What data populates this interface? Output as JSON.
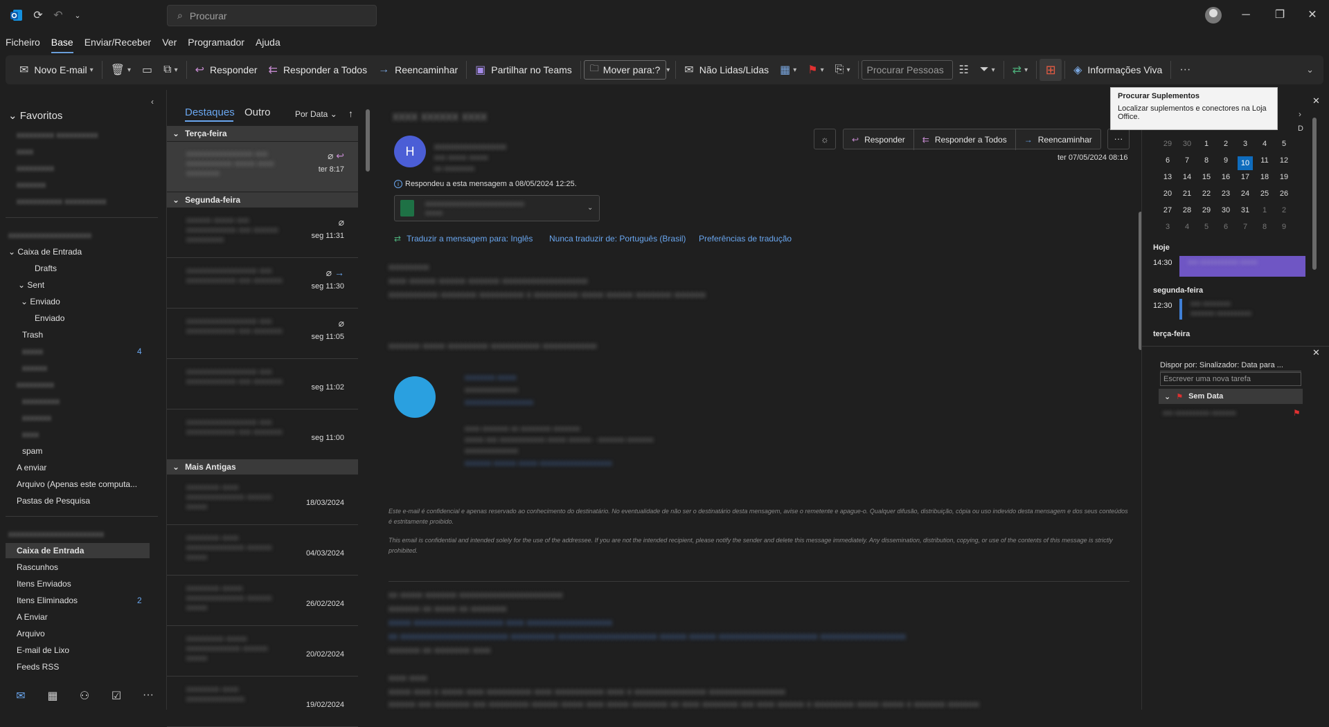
{
  "titlebar": {
    "search_placeholder": "Procurar"
  },
  "menu": {
    "items": [
      "Ficheiro",
      "Base",
      "Enviar/Receber",
      "Ver",
      "Programador",
      "Ajuda"
    ],
    "active": "Base"
  },
  "ribbon": {
    "new_email": "Novo E-mail",
    "reply": "Responder",
    "reply_all": "Responder a Todos",
    "forward": "Reencaminhar",
    "share_teams": "Partilhar no Teams",
    "move_to": "Mover para:?",
    "unread_read": "Não Lidas/Lidas",
    "search_people_placeholder": "Procurar Pessoas",
    "viva_insights": "Informações Viva"
  },
  "tooltip": {
    "title": "Procurar Suplementos",
    "body": "Localizar suplementos e conectores na Loja Office."
  },
  "folders": {
    "favorites_label": "Favoritos",
    "account1": [
      {
        "label": "Caixa de Entrada"
      },
      {
        "label": "Drafts"
      },
      {
        "label": "Sent"
      },
      {
        "label": "Enviado"
      },
      {
        "label": "Enviado"
      },
      {
        "label": "Trash"
      },
      {
        "label": "spam"
      },
      {
        "label": "A enviar"
      },
      {
        "label": "Arquivo (Apenas este computa..."
      },
      {
        "label": "Pastas de Pesquisa"
      }
    ],
    "blurred_count": "4",
    "account2": [
      {
        "label": "Caixa de Entrada"
      },
      {
        "label": "Rascunhos"
      },
      {
        "label": "Itens Enviados"
      },
      {
        "label": "Itens Eliminados",
        "count": "2"
      },
      {
        "label": "A Enviar"
      },
      {
        "label": "Arquivo"
      },
      {
        "label": "E-mail de Lixo"
      },
      {
        "label": "Feeds RSS"
      }
    ]
  },
  "message_list": {
    "tabs": [
      "Destaques",
      "Outro"
    ],
    "sort": "Por Data",
    "groups": {
      "g1": "Terça-feira",
      "g2": "Segunda-feira",
      "g3": "Mais Antigas"
    },
    "messages": [
      {
        "date": "ter 8:17"
      },
      {
        "date": "seg 11:31"
      },
      {
        "date": "seg 11:30"
      },
      {
        "date": "seg 11:05"
      },
      {
        "date": "seg 11:02"
      },
      {
        "date": "seg 11:00"
      },
      {
        "date": "18/03/2024"
      },
      {
        "date": "04/03/2024"
      },
      {
        "date": "26/02/2024"
      },
      {
        "date": "20/02/2024"
      },
      {
        "date": "19/02/2024"
      }
    ]
  },
  "reading": {
    "avatar_letter": "H",
    "reply": "Responder",
    "reply_all": "Responder a Todos",
    "forward": "Reencaminhar",
    "datetime": "ter 07/05/2024 08:16",
    "replied_info": "Respondeu a esta mensagem a 08/05/2024 12:25.",
    "translate": "Traduzir a mensagem para: Inglês",
    "never_translate": "Nunca traduzir de: Português (Brasil)",
    "translate_prefs": "Preferências de tradução",
    "disclaimer_pt": "Este e-mail é confidencial e apenas reservado ao conhecimento do destinatário. No eventualidade de não ser o destinatário desta mensagem, avise o remetente e apague-o. Qualquer difusão, distribuição, cópia ou uso indevido desta mensagem e dos seus conteúdos é estritamente proibido.",
    "disclaimer_en": "This email is confidential and intended solely for the use of the addressee. If you are not the intended recipient, please notify the sender and delete this message immediately. Any dissemination, distribution, copying, or use of the contents of this message is strictly prohibited."
  },
  "calendar": {
    "weekday_last": "D",
    "weeks": [
      [
        "29",
        "30",
        "1",
        "2",
        "3",
        "4",
        "5"
      ],
      [
        "6",
        "7",
        "8",
        "9",
        "10",
        "11",
        "12"
      ],
      [
        "13",
        "14",
        "15",
        "16",
        "17",
        "18",
        "19"
      ],
      [
        "20",
        "21",
        "22",
        "23",
        "24",
        "25",
        "26"
      ],
      [
        "27",
        "28",
        "29",
        "30",
        "31",
        "1",
        "2"
      ],
      [
        "3",
        "4",
        "5",
        "6",
        "7",
        "8",
        "9"
      ]
    ],
    "today": "10",
    "agenda": {
      "today_label": "Hoje",
      "today_time": "14:30",
      "monday_label": "segunda-feira",
      "monday_time": "12:30",
      "tuesday_label": "terça-feira"
    }
  },
  "tasks": {
    "arrange_by": "Dispor por: Sinalizador: Data para ...",
    "new_task_placeholder": "Escrever uma nova tarefa",
    "no_date": "Sem Data"
  },
  "colors": {
    "accent": "#0f6cbd",
    "link": "#6aa7f0",
    "flag": "#e03131"
  }
}
